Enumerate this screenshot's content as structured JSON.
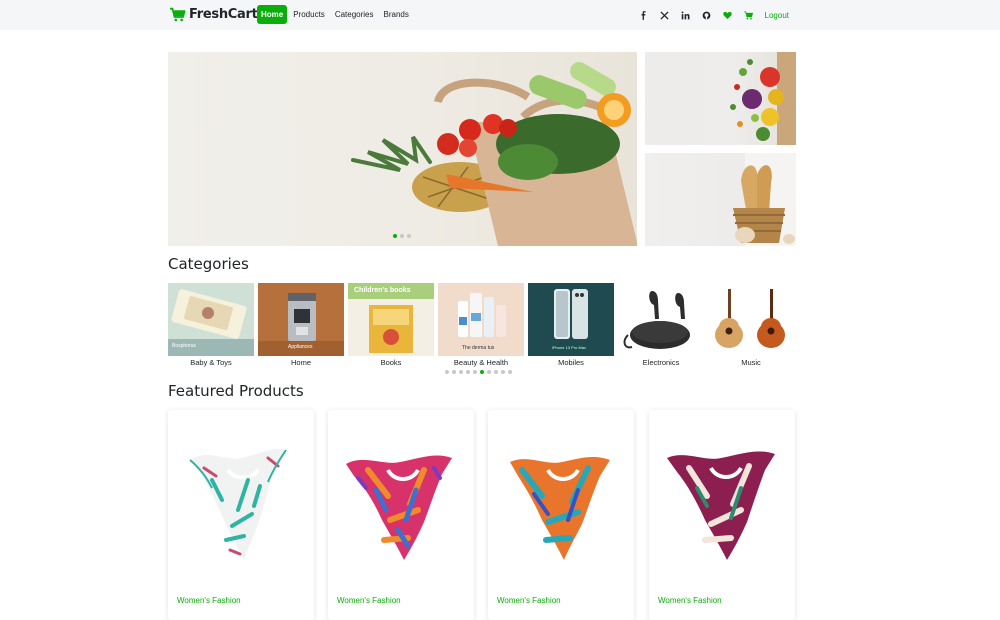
{
  "brand": {
    "name": "FreshCart",
    "icon": "cart-icon"
  },
  "nav": {
    "links": [
      {
        "label": "Home",
        "active": true
      },
      {
        "label": "Products",
        "active": false
      },
      {
        "label": "Categories",
        "active": false
      },
      {
        "label": "Brands",
        "active": false
      }
    ],
    "social_icons": [
      "facebook-icon",
      "x-twitter-icon",
      "linkedin-icon",
      "github-icon"
    ],
    "wishlist_icon": "heart-icon",
    "cart_icon": "cart-icon",
    "logout_label": "Logout"
  },
  "hero": {
    "slide_count": 3,
    "active_slide": 1
  },
  "categories": {
    "title": "Categories",
    "items": [
      {
        "label": "Baby & Toys",
        "caption": "Bosphorus"
      },
      {
        "label": "Home",
        "caption": "Appliances"
      },
      {
        "label": "Books",
        "caption": "Children's books"
      },
      {
        "label": "Beauty & Health",
        "caption": "The derma tus"
      },
      {
        "label": "Mobiles",
        "caption": "iPhone 13 Pro Max"
      },
      {
        "label": "Electronics",
        "caption": ""
      },
      {
        "label": "Music",
        "caption": ""
      }
    ],
    "dot_count": 10,
    "active_dot": 5
  },
  "featured": {
    "title": "Featured Products",
    "products": [
      {
        "category": "Women's Fashion"
      },
      {
        "category": "Women's Fashion"
      },
      {
        "category": "Women's Fashion"
      },
      {
        "category": "Women's Fashion"
      }
    ]
  },
  "colors": {
    "accent": "#0aad0a",
    "navbar_bg": "#f4f6f8"
  }
}
